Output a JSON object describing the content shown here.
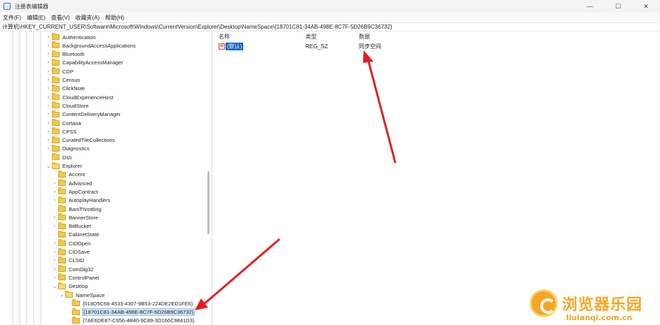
{
  "window": {
    "title": "注册表编辑器",
    "controls": [
      "—",
      "☐",
      "✕"
    ]
  },
  "menu": [
    "文件(F)",
    "编辑(E)",
    "查看(V)",
    "收藏夹(A)",
    "帮助(H)"
  ],
  "address": "计算机\\HKEY_CURRENT_USER\\Software\\Microsoft\\Windows\\CurrentVersion\\Explorer\\Desktop\\NameSpace\\{18701C81-34AB-498E-8C7F-5D26B9C36732}",
  "tree": [
    {
      "label": "Authentication",
      "depth": 0,
      "chev": "›",
      "open": false
    },
    {
      "label": "BackgroundAccessApplications",
      "depth": 0,
      "chev": "›",
      "open": false
    },
    {
      "label": "Bluetooth",
      "depth": 0,
      "chev": "›",
      "open": false
    },
    {
      "label": "CapabilityAccessManager",
      "depth": 0,
      "chev": "›",
      "open": false
    },
    {
      "label": "CDP",
      "depth": 0,
      "chev": "›",
      "open": false
    },
    {
      "label": "Census",
      "depth": 0,
      "chev": "›",
      "open": false
    },
    {
      "label": "ClickNote",
      "depth": 0,
      "chev": "›",
      "open": false
    },
    {
      "label": "CloudExperienceHost",
      "depth": 0,
      "chev": "›",
      "open": false
    },
    {
      "label": "CloudStore",
      "depth": 0,
      "chev": "›",
      "open": false
    },
    {
      "label": "ContentDeliveryManager",
      "depth": 0,
      "chev": "›",
      "open": false
    },
    {
      "label": "Cortana",
      "depth": 0,
      "chev": "›",
      "open": false
    },
    {
      "label": "CPSS",
      "depth": 0,
      "chev": "›",
      "open": false
    },
    {
      "label": "CuratedTileCollections",
      "depth": 0,
      "chev": "›",
      "open": false
    },
    {
      "label": "Diagnostics",
      "depth": 0,
      "chev": "›",
      "open": false
    },
    {
      "label": "Dsh",
      "depth": 0,
      "chev": "",
      "open": false
    },
    {
      "label": "Explorer",
      "depth": 0,
      "chev": "⌄",
      "open": true
    },
    {
      "label": "Accent",
      "depth": 1,
      "chev": "",
      "open": false
    },
    {
      "label": "Advanced",
      "depth": 1,
      "chev": "›",
      "open": false
    },
    {
      "label": "AppContract",
      "depth": 1,
      "chev": "›",
      "open": false
    },
    {
      "label": "AutoplayHandlers",
      "depth": 1,
      "chev": "›",
      "open": false
    },
    {
      "label": "BamThrottling",
      "depth": 1,
      "chev": "",
      "open": false
    },
    {
      "label": "BannerStore",
      "depth": 1,
      "chev": "›",
      "open": false
    },
    {
      "label": "BitBucket",
      "depth": 1,
      "chev": "›",
      "open": false
    },
    {
      "label": "CabinetState",
      "depth": 1,
      "chev": "",
      "open": false
    },
    {
      "label": "CIDOpen",
      "depth": 1,
      "chev": "›",
      "open": false
    },
    {
      "label": "CIDSave",
      "depth": 1,
      "chev": "›",
      "open": false
    },
    {
      "label": "CLSID",
      "depth": 1,
      "chev": "›",
      "open": false
    },
    {
      "label": "ComDlg32",
      "depth": 1,
      "chev": "›",
      "open": false
    },
    {
      "label": "ControlPanel",
      "depth": 1,
      "chev": "›",
      "open": false
    },
    {
      "label": "Desktop",
      "depth": 1,
      "chev": "⌄",
      "open": true
    },
    {
      "label": "NameSpace",
      "depth": 2,
      "chev": "⌄",
      "open": true
    },
    {
      "label": "{018D5C66-4533-4307-9B53-224DE2ED1FE6}",
      "depth": 3,
      "chev": "",
      "open": false
    },
    {
      "label": "{18701C81-34AB-498E-8C7F-5D26B9C36732}",
      "depth": 3,
      "chev": "",
      "open": false,
      "selected": true
    },
    {
      "label": "{7AE6DE87-C956-4B40-9C89-3D166C9841D3}",
      "depth": 3,
      "chev": "",
      "open": false
    }
  ],
  "list": {
    "headers": {
      "name": "名称",
      "type": "类型",
      "data": "数据"
    },
    "rows": [
      {
        "icon": "ab",
        "name": "(默认)",
        "type": "REG_SZ",
        "data": "同步空间"
      }
    ]
  },
  "watermark": {
    "title": "浏览器乐园",
    "url": "liulanqi.com.cn"
  },
  "colors": {
    "accent": "#0a64c8",
    "arrow": "#e02020",
    "watermark": "#f5a623"
  }
}
